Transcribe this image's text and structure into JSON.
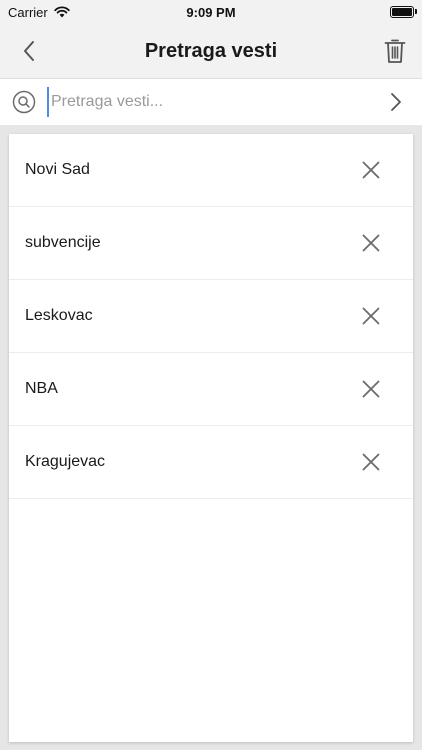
{
  "status": {
    "carrier": "Carrier",
    "time": "9:09 PM"
  },
  "nav": {
    "title": "Pretraga vesti"
  },
  "search": {
    "placeholder": "Pretraga vesti...",
    "value": ""
  },
  "history": [
    {
      "label": "Novi Sad"
    },
    {
      "label": "subvencije"
    },
    {
      "label": "Leskovac"
    },
    {
      "label": "NBA"
    },
    {
      "label": "Kragujevac"
    }
  ],
  "icons": {
    "back": "chevron-left-icon",
    "trash": "trash-icon",
    "search": "search-icon",
    "go": "chevron-right-icon",
    "remove": "close-icon",
    "wifi": "wifi-icon",
    "battery": "battery-icon"
  },
  "colors": {
    "caret": "#4a90e2",
    "icon": "#6b6b6b"
  }
}
